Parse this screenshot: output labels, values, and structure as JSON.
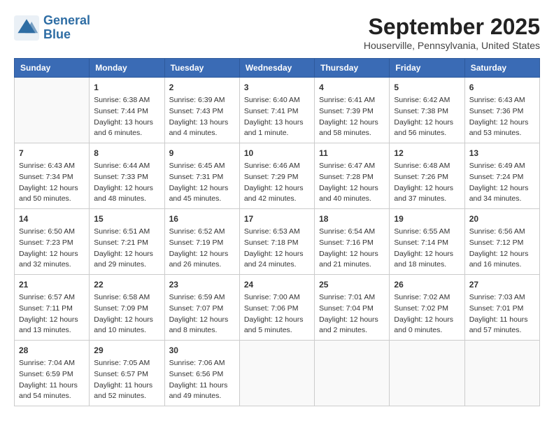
{
  "header": {
    "logo_line1": "General",
    "logo_line2": "Blue",
    "month": "September 2025",
    "location": "Houserville, Pennsylvania, United States"
  },
  "days_of_week": [
    "Sunday",
    "Monday",
    "Tuesday",
    "Wednesday",
    "Thursday",
    "Friday",
    "Saturday"
  ],
  "weeks": [
    [
      {
        "day": "",
        "info": ""
      },
      {
        "day": "1",
        "info": "Sunrise: 6:38 AM\nSunset: 7:44 PM\nDaylight: 13 hours\nand 6 minutes."
      },
      {
        "day": "2",
        "info": "Sunrise: 6:39 AM\nSunset: 7:43 PM\nDaylight: 13 hours\nand 4 minutes."
      },
      {
        "day": "3",
        "info": "Sunrise: 6:40 AM\nSunset: 7:41 PM\nDaylight: 13 hours\nand 1 minute."
      },
      {
        "day": "4",
        "info": "Sunrise: 6:41 AM\nSunset: 7:39 PM\nDaylight: 12 hours\nand 58 minutes."
      },
      {
        "day": "5",
        "info": "Sunrise: 6:42 AM\nSunset: 7:38 PM\nDaylight: 12 hours\nand 56 minutes."
      },
      {
        "day": "6",
        "info": "Sunrise: 6:43 AM\nSunset: 7:36 PM\nDaylight: 12 hours\nand 53 minutes."
      }
    ],
    [
      {
        "day": "7",
        "info": "Sunrise: 6:43 AM\nSunset: 7:34 PM\nDaylight: 12 hours\nand 50 minutes."
      },
      {
        "day": "8",
        "info": "Sunrise: 6:44 AM\nSunset: 7:33 PM\nDaylight: 12 hours\nand 48 minutes."
      },
      {
        "day": "9",
        "info": "Sunrise: 6:45 AM\nSunset: 7:31 PM\nDaylight: 12 hours\nand 45 minutes."
      },
      {
        "day": "10",
        "info": "Sunrise: 6:46 AM\nSunset: 7:29 PM\nDaylight: 12 hours\nand 42 minutes."
      },
      {
        "day": "11",
        "info": "Sunrise: 6:47 AM\nSunset: 7:28 PM\nDaylight: 12 hours\nand 40 minutes."
      },
      {
        "day": "12",
        "info": "Sunrise: 6:48 AM\nSunset: 7:26 PM\nDaylight: 12 hours\nand 37 minutes."
      },
      {
        "day": "13",
        "info": "Sunrise: 6:49 AM\nSunset: 7:24 PM\nDaylight: 12 hours\nand 34 minutes."
      }
    ],
    [
      {
        "day": "14",
        "info": "Sunrise: 6:50 AM\nSunset: 7:23 PM\nDaylight: 12 hours\nand 32 minutes."
      },
      {
        "day": "15",
        "info": "Sunrise: 6:51 AM\nSunset: 7:21 PM\nDaylight: 12 hours\nand 29 minutes."
      },
      {
        "day": "16",
        "info": "Sunrise: 6:52 AM\nSunset: 7:19 PM\nDaylight: 12 hours\nand 26 minutes."
      },
      {
        "day": "17",
        "info": "Sunrise: 6:53 AM\nSunset: 7:18 PM\nDaylight: 12 hours\nand 24 minutes."
      },
      {
        "day": "18",
        "info": "Sunrise: 6:54 AM\nSunset: 7:16 PM\nDaylight: 12 hours\nand 21 minutes."
      },
      {
        "day": "19",
        "info": "Sunrise: 6:55 AM\nSunset: 7:14 PM\nDaylight: 12 hours\nand 18 minutes."
      },
      {
        "day": "20",
        "info": "Sunrise: 6:56 AM\nSunset: 7:12 PM\nDaylight: 12 hours\nand 16 minutes."
      }
    ],
    [
      {
        "day": "21",
        "info": "Sunrise: 6:57 AM\nSunset: 7:11 PM\nDaylight: 12 hours\nand 13 minutes."
      },
      {
        "day": "22",
        "info": "Sunrise: 6:58 AM\nSunset: 7:09 PM\nDaylight: 12 hours\nand 10 minutes."
      },
      {
        "day": "23",
        "info": "Sunrise: 6:59 AM\nSunset: 7:07 PM\nDaylight: 12 hours\nand 8 minutes."
      },
      {
        "day": "24",
        "info": "Sunrise: 7:00 AM\nSunset: 7:06 PM\nDaylight: 12 hours\nand 5 minutes."
      },
      {
        "day": "25",
        "info": "Sunrise: 7:01 AM\nSunset: 7:04 PM\nDaylight: 12 hours\nand 2 minutes."
      },
      {
        "day": "26",
        "info": "Sunrise: 7:02 AM\nSunset: 7:02 PM\nDaylight: 12 hours\nand 0 minutes."
      },
      {
        "day": "27",
        "info": "Sunrise: 7:03 AM\nSunset: 7:01 PM\nDaylight: 11 hours\nand 57 minutes."
      }
    ],
    [
      {
        "day": "28",
        "info": "Sunrise: 7:04 AM\nSunset: 6:59 PM\nDaylight: 11 hours\nand 54 minutes."
      },
      {
        "day": "29",
        "info": "Sunrise: 7:05 AM\nSunset: 6:57 PM\nDaylight: 11 hours\nand 52 minutes."
      },
      {
        "day": "30",
        "info": "Sunrise: 7:06 AM\nSunset: 6:56 PM\nDaylight: 11 hours\nand 49 minutes."
      },
      {
        "day": "",
        "info": ""
      },
      {
        "day": "",
        "info": ""
      },
      {
        "day": "",
        "info": ""
      },
      {
        "day": "",
        "info": ""
      }
    ]
  ]
}
